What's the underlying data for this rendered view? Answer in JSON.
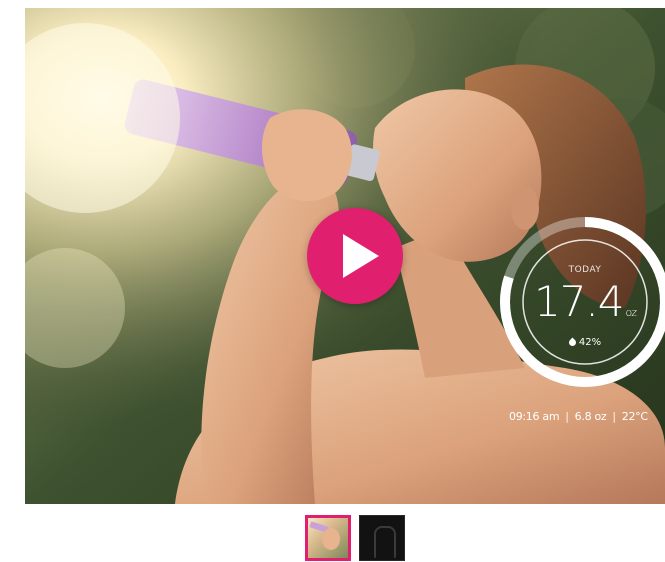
{
  "video": {
    "play_button": "play",
    "overlay": {
      "label": "TODAY",
      "value": "17.4",
      "unit": "oz",
      "percent": "42%",
      "progress_fraction": 0.8
    },
    "stats": {
      "time": "09:16 am",
      "amount": "6.8 oz",
      "temperature": "22°C",
      "separator": "|"
    }
  },
  "thumbnails": [
    {
      "name": "Drinking video",
      "selected": true
    },
    {
      "name": "Bottle image",
      "selected": false
    }
  ],
  "colors": {
    "accent": "#e0206e",
    "ring": "#ffffff"
  },
  "icons": {
    "play": "play-icon",
    "drop": "water-drop-icon"
  }
}
